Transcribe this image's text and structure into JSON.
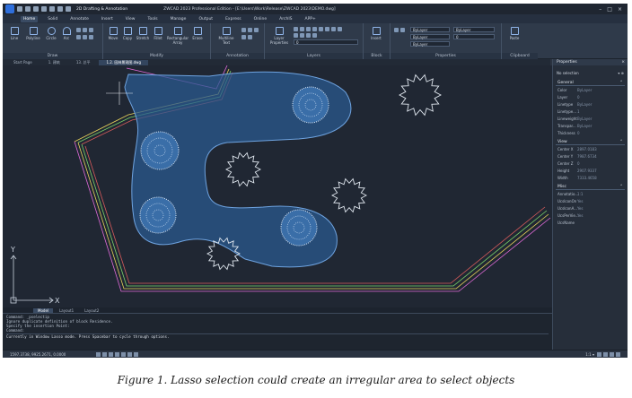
{
  "title_bar": {
    "workspace": "2D Drafting & Annotation",
    "document_title": "ZWCAD 2023 Professional Edition - [E:\\Users\\Work\\Release\\ZWCAD 2023\\DEMO.dwg]",
    "window_controls": [
      "–",
      "□",
      "×"
    ]
  },
  "ribbon_tabs": [
    "Home",
    "Solid",
    "Annotate",
    "Insert",
    "View",
    "Tools",
    "Manage",
    "Output",
    "Express",
    "Online",
    "ArchIS",
    "APP+"
  ],
  "ribbon": {
    "draw": {
      "title": "Draw",
      "tools": [
        "Line",
        "Polyline",
        "Circle",
        "Arc"
      ]
    },
    "modify": {
      "title": "Modify",
      "tools": [
        "Move",
        "Copy",
        "Stretch",
        "Fillet",
        "Rectangular Array",
        "Erase"
      ]
    },
    "annotation": {
      "title": "Annotation",
      "tools": [
        "Multiline Text"
      ]
    },
    "layers": {
      "title": "Layers",
      "tools": [
        "Layer Properties"
      ],
      "current_layer": "0"
    },
    "block": {
      "title": "Block",
      "tools": [
        "Insert"
      ]
    },
    "properties": {
      "title": "Properties",
      "color": "ByLayer",
      "linetype": "ByLayer",
      "lineweight": "ByLayer",
      "transparency": "0"
    },
    "clipboard": {
      "title": "Clipboard",
      "tools": [
        "Paste"
      ]
    }
  },
  "doc_tabs": [
    "Start Page",
    "1. 建筑",
    "13. 总平",
    "1.2. 园林景观图.dwg"
  ],
  "layout_tabs": [
    "Model",
    "Layout1",
    "Layout2"
  ],
  "command_lines": [
    "Command: _pselectip",
    "Ignore duplicate definition of block Residence.",
    "Specify the insertion Point:",
    "Command:"
  ],
  "command_prompt": "Currently in Window Lasso mode. Press Spacebar to cycle through options.",
  "status": {
    "coordinates": "1597.3738, 9925.2671, 0.0000",
    "scale": "1:1 ▾"
  },
  "properties_panel": {
    "title": "Properties",
    "selection": "No selection",
    "general": {
      "title": "General",
      "rows": [
        {
          "k": "Color",
          "v": "ByLayer"
        },
        {
          "k": "Layer",
          "v": "0"
        },
        {
          "k": "Linetype",
          "v": "ByLayer"
        },
        {
          "k": "Linetype...",
          "v": "1"
        },
        {
          "k": "Lineweight",
          "v": "ByLayer"
        },
        {
          "k": "Transpar...",
          "v": "ByLayer"
        },
        {
          "k": "Thickness",
          "v": "0"
        }
      ]
    },
    "view": {
      "title": "View",
      "rows": [
        {
          "k": "Center X",
          "v": "2897.0183"
        },
        {
          "k": "Center Y",
          "v": "7987.6734"
        },
        {
          "k": "Center Z",
          "v": "0"
        },
        {
          "k": "Height",
          "v": "2907.9337"
        },
        {
          "k": "Width",
          "v": "7333.4658"
        }
      ]
    },
    "misc": {
      "title": "Misc",
      "rows": [
        {
          "k": "Annotatio...",
          "v": "1:1"
        },
        {
          "k": "UcsIconOn",
          "v": "Yes"
        },
        {
          "k": "UcsIconA...",
          "v": "Yes"
        },
        {
          "k": "UcsPerVie...",
          "v": "Yes"
        },
        {
          "k": "UcsName",
          "v": ""
        }
      ]
    }
  },
  "canvas": {
    "axis_x": "X",
    "axis_y": "Y"
  },
  "colors": {
    "lasso_fill": "#2a5a8f",
    "lasso_stroke": "#6ea3e0",
    "canvas_bg": "#202733"
  },
  "caption": "Figure 1. Lasso selection could create an irregular area to select objects"
}
